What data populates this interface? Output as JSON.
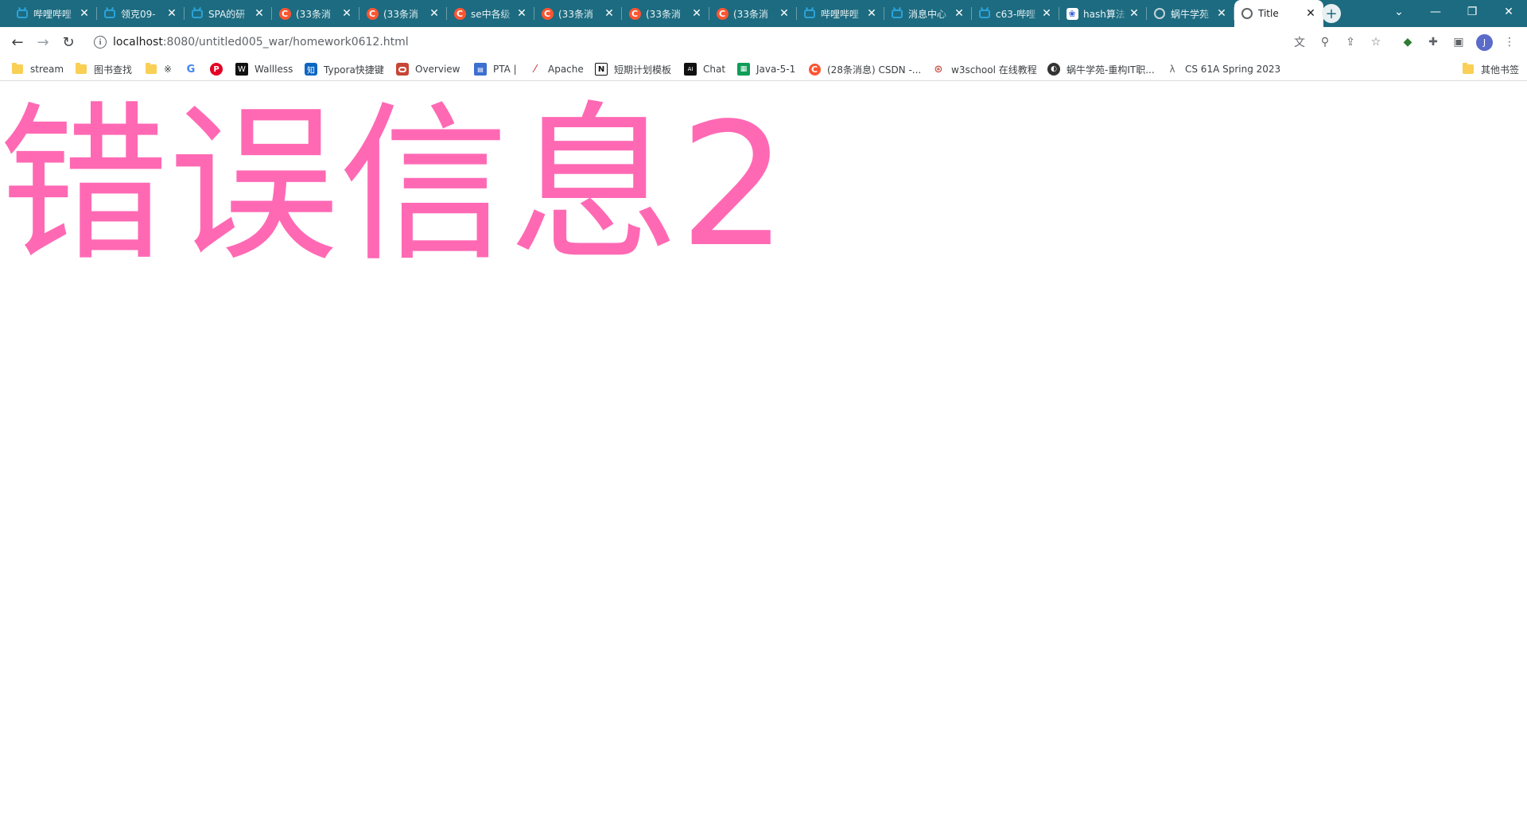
{
  "browser": {
    "tabs": [
      {
        "title": "哔哩哔哩",
        "icon": "bilibili-icon"
      },
      {
        "title": "领克09-",
        "icon": "bilibili-icon"
      },
      {
        "title": "SPA的研",
        "icon": "bilibili-icon"
      },
      {
        "title": "(33条消",
        "icon": "csdn-icon"
      },
      {
        "title": "(33条消",
        "icon": "csdn-icon"
      },
      {
        "title": "se中各级",
        "icon": "csdn-icon"
      },
      {
        "title": "(33条消",
        "icon": "csdn-icon"
      },
      {
        "title": "(33条消",
        "icon": "csdn-icon"
      },
      {
        "title": "(33条消",
        "icon": "csdn-icon"
      },
      {
        "title": "哔哩哔哩",
        "icon": "bilibili-icon"
      },
      {
        "title": "消息中心",
        "icon": "bilibili-icon"
      },
      {
        "title": "c63-哔哩",
        "icon": "bilibili-icon"
      },
      {
        "title": "hash算法",
        "icon": "baidu-icon"
      },
      {
        "title": "蜗牛学苑",
        "icon": "globe-icon"
      },
      {
        "title": "Title",
        "icon": "globe-icon",
        "active": true
      }
    ],
    "url": {
      "host": "localhost",
      "path": ":8080/untitled005_war/homework0612.html"
    },
    "profile_initial": "J",
    "bookmarks": [
      {
        "label": "stream",
        "icon": "folder-icon"
      },
      {
        "label": "图书查找",
        "icon": "folder-icon"
      },
      {
        "label": "※",
        "icon": "folder-icon"
      },
      {
        "label": "",
        "icon": "google-icon"
      },
      {
        "label": "",
        "icon": "pinterest-icon"
      },
      {
        "label": "Wallless",
        "icon": "wallless-icon"
      },
      {
        "label": "Typora快捷键",
        "icon": "zhihu-icon"
      },
      {
        "label": "Overview",
        "icon": "oracle-icon"
      },
      {
        "label": "PTA |",
        "icon": "pta-icon"
      },
      {
        "label": "Apache",
        "icon": "apache-feather-icon"
      },
      {
        "label": "短期计划模板",
        "icon": "notion-icon"
      },
      {
        "label": "Chat",
        "icon": "chat-icon"
      },
      {
        "label": "Java-5-1",
        "icon": "sheets-icon"
      },
      {
        "label": "(28条消息) CSDN -...",
        "icon": "csdn-icon"
      },
      {
        "label": "w3school 在线教程",
        "icon": "w3school-icon"
      },
      {
        "label": "蜗牛学苑-重构IT职...",
        "icon": "snail-icon"
      },
      {
        "label": "CS 61A Spring 2023",
        "icon": "lambda-icon"
      }
    ],
    "other_bookmarks": "其他书签"
  },
  "page": {
    "heading": "错误信息2",
    "heading_color": "#ff69b4"
  },
  "colors": {
    "tabstrip": "#1d6b80",
    "csdn": "#fc5531",
    "bilibili": "#2aa3d8"
  }
}
